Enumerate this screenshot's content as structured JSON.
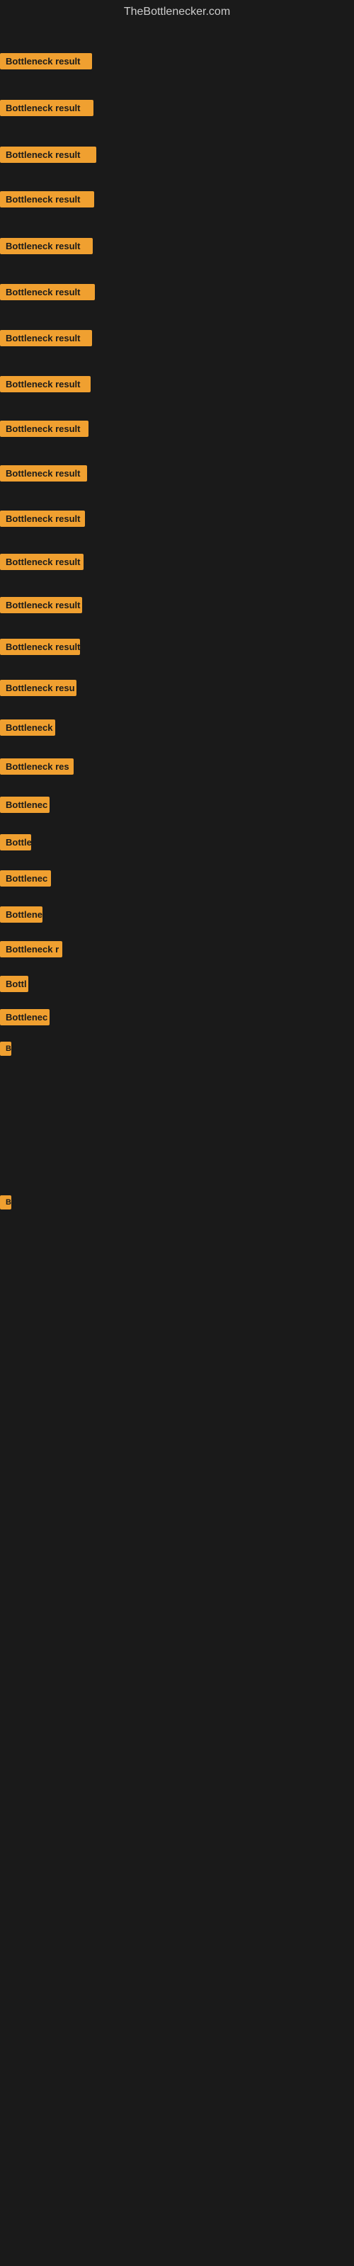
{
  "site": {
    "title": "TheBottlenecker.com"
  },
  "items": [
    {
      "id": 1,
      "label": "Bottleneck result",
      "width": 130,
      "spacing": 60
    },
    {
      "id": 2,
      "label": "Bottleneck result",
      "width": 132,
      "spacing": 60
    },
    {
      "id": 3,
      "label": "Bottleneck result",
      "width": 136,
      "spacing": 60
    },
    {
      "id": 4,
      "label": "Bottleneck result",
      "width": 133,
      "spacing": 55
    },
    {
      "id": 5,
      "label": "Bottleneck result",
      "width": 131,
      "spacing": 60
    },
    {
      "id": 6,
      "label": "Bottleneck result",
      "width": 134,
      "spacing": 58
    },
    {
      "id": 7,
      "label": "Bottleneck result",
      "width": 130,
      "spacing": 58
    },
    {
      "id": 8,
      "label": "Bottleneck result",
      "width": 128,
      "spacing": 58
    },
    {
      "id": 9,
      "label": "Bottleneck result",
      "width": 125,
      "spacing": 55
    },
    {
      "id": 10,
      "label": "Bottleneck result",
      "width": 123,
      "spacing": 55
    },
    {
      "id": 11,
      "label": "Bottleneck result",
      "width": 120,
      "spacing": 55
    },
    {
      "id": 12,
      "label": "Bottleneck result",
      "width": 118,
      "spacing": 52
    },
    {
      "id": 13,
      "label": "Bottleneck result",
      "width": 116,
      "spacing": 50
    },
    {
      "id": 14,
      "label": "Bottleneck result",
      "width": 113,
      "spacing": 48
    },
    {
      "id": 15,
      "label": "Bottleneck resu",
      "width": 108,
      "spacing": 45
    },
    {
      "id": 16,
      "label": "Bottleneck",
      "width": 78,
      "spacing": 42
    },
    {
      "id": 17,
      "label": "Bottleneck res",
      "width": 104,
      "spacing": 40
    },
    {
      "id": 18,
      "label": "Bottlenec",
      "width": 70,
      "spacing": 38
    },
    {
      "id": 19,
      "label": "Bottle",
      "width": 44,
      "spacing": 36
    },
    {
      "id": 20,
      "label": "Bottlenec",
      "width": 72,
      "spacing": 34
    },
    {
      "id": 21,
      "label": "Bottlene",
      "width": 60,
      "spacing": 32
    },
    {
      "id": 22,
      "label": "Bottleneck r",
      "width": 88,
      "spacing": 30
    },
    {
      "id": 23,
      "label": "Bottl",
      "width": 40,
      "spacing": 28
    },
    {
      "id": 24,
      "label": "Bottlenec",
      "width": 70,
      "spacing": 26
    },
    {
      "id": 25,
      "label": "B",
      "width": 14,
      "spacing": 24
    },
    {
      "id": 26,
      "label": "",
      "width": 0,
      "spacing": 100
    },
    {
      "id": 27,
      "label": "",
      "width": 0,
      "spacing": 140
    },
    {
      "id": 28,
      "label": "B",
      "width": 14,
      "spacing": 100
    },
    {
      "id": 29,
      "label": "",
      "width": 0,
      "spacing": 120
    },
    {
      "id": 30,
      "label": "",
      "width": 0,
      "spacing": 100
    },
    {
      "id": 31,
      "label": "",
      "width": 0,
      "spacing": 100
    }
  ],
  "colors": {
    "badge_bg": "#f0a030",
    "badge_text": "#1a1a1a",
    "background": "#1a1a1a",
    "title": "#cccccc"
  }
}
